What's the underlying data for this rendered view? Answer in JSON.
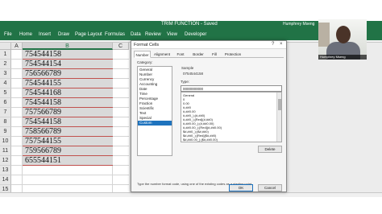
{
  "window": {
    "title": "TRIM FUNCTION - Saved",
    "user": "Humphrey Mseng",
    "webcam_label": "Humphrey Mseng"
  },
  "ribbon": {
    "tabs": [
      "File",
      "Home",
      "Insert",
      "Draw",
      "Page Layout",
      "Formulas",
      "Data",
      "Review",
      "View",
      "Developer"
    ]
  },
  "sheet": {
    "col_headers": [
      "A",
      "B",
      "C"
    ],
    "row_numbers": [
      "1",
      "2",
      "3",
      "4",
      "5",
      "6",
      "7",
      "8",
      "9",
      "10",
      "11",
      "12",
      "13",
      "14",
      "15"
    ],
    "values": [
      "754544158",
      "754544154",
      "756566789",
      "754544155",
      "754544168",
      "754544158",
      "757566789",
      "754544158",
      "758566789",
      "757544155",
      "759566789",
      "655544151"
    ]
  },
  "dialog": {
    "title": "Format Cells",
    "help": "?",
    "close": "×",
    "tabs": [
      "Number",
      "Alignment",
      "Font",
      "Border",
      "Fill",
      "Protection"
    ],
    "active_tab": "Number",
    "category_label": "Category:",
    "categories": [
      "General",
      "Number",
      "Currency",
      "Accounting",
      "Date",
      "Time",
      "Percentage",
      "Fraction",
      "Scientific",
      "Text",
      "Special",
      "Custom"
    ],
    "selected_category": "Custom",
    "sample_label": "Sample",
    "sample_value": "0754544158",
    "type_label": "Type:",
    "type_value": "0000000000",
    "formats": [
      "General",
      "0",
      "0.00",
      "#,##0",
      "#,##0.00",
      "#,##0_);(#,##0)",
      "#,##0_);[Red](#,##0)",
      "#,##0.00_);(#,##0.00)",
      "#,##0.00_);[Red](#,##0.00)",
      "$#,##0_);($#,##0)",
      "$#,##0_);[Red]($#,##0)",
      "$#,##0.00_);($#,##0.00)"
    ],
    "delete_label": "Delete",
    "hint": "Type the number format code, using one of the existing codes as a starting point.",
    "ok_label": "OK",
    "cancel_label": "Cancel"
  }
}
